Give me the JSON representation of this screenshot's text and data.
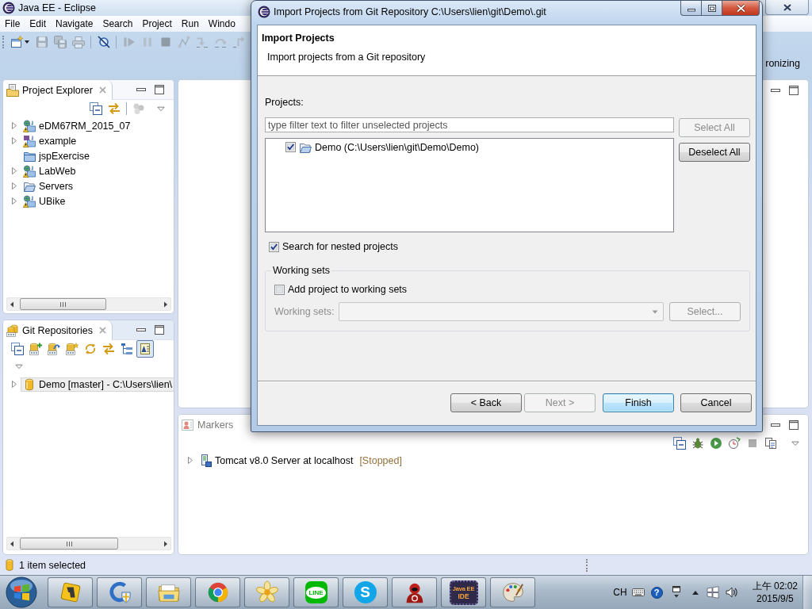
{
  "window": {
    "title": "Java EE - Eclipse"
  },
  "menu": [
    {
      "label": "File"
    },
    {
      "label": "Edit"
    },
    {
      "label": "Navigate"
    },
    {
      "label": "Search"
    },
    {
      "label": "Project"
    },
    {
      "label": "Run"
    },
    {
      "label": "Windo"
    }
  ],
  "toolbar": [
    {
      "kind": "new",
      "disabled": false
    },
    {
      "kind": "dropdown",
      "disabled": false
    },
    {
      "kind": "save",
      "disabled": true
    },
    {
      "kind": "save-all",
      "disabled": true
    },
    {
      "kind": "print",
      "disabled": true
    },
    {
      "kind": "separator"
    },
    {
      "kind": "skip-breakpoints",
      "disabled": false
    },
    {
      "kind": "separator"
    },
    {
      "kind": "resume",
      "disabled": true
    },
    {
      "kind": "suspend",
      "disabled": true
    },
    {
      "kind": "terminate",
      "disabled": true
    },
    {
      "kind": "disconnect",
      "disabled": true
    },
    {
      "kind": "step-into",
      "disabled": true
    },
    {
      "kind": "step-over",
      "disabled": true
    },
    {
      "kind": "step-return",
      "disabled": true
    },
    {
      "kind": "separator"
    }
  ],
  "perspective_bar": {
    "label": "ronizing"
  },
  "project_explorer": {
    "title": "Project Explorer",
    "toolbar": [
      {
        "kind": "collapse-all",
        "disabled": false
      },
      {
        "kind": "link",
        "disabled": false
      },
      {
        "kind": "separator"
      },
      {
        "kind": "filters",
        "disabled": true
      },
      {
        "kind": "view-menu",
        "disabled": false
      }
    ],
    "items": [
      {
        "label": "eDM67RM_2015_07",
        "kind": "web-project",
        "expandable": true,
        "expanded": false,
        "selected": false
      },
      {
        "label": "example",
        "kind": "maven-project",
        "expandable": true,
        "expanded": false,
        "selected": false
      },
      {
        "label": "jspExercise",
        "kind": "closed-project",
        "expandable": false,
        "selected": false
      },
      {
        "label": "LabWeb",
        "kind": "web-project",
        "expandable": true,
        "expanded": false,
        "selected": false
      },
      {
        "label": "Servers",
        "kind": "folder",
        "expandable": true,
        "expanded": false,
        "selected": false
      },
      {
        "label": "UBike",
        "kind": "web-project",
        "expandable": true,
        "expanded": false,
        "selected": false
      }
    ]
  },
  "git_repositories": {
    "title": "Git Repositories",
    "toolbar": [
      {
        "kind": "collapse-all",
        "pressed": false
      },
      {
        "kind": "add-repository",
        "pressed": false
      },
      {
        "kind": "clone-repository",
        "pressed": false
      },
      {
        "kind": "create-repository",
        "pressed": false
      },
      {
        "kind": "refresh",
        "pressed": false
      },
      {
        "kind": "link",
        "pressed": false
      },
      {
        "kind": "hierarchy",
        "pressed": false
      },
      {
        "kind": "show-details",
        "pressed": true
      }
    ],
    "items": [
      {
        "label": "Demo [master] - C:\\Users\\lien\\",
        "kind": "repository",
        "expandable": true,
        "expanded": false,
        "selected": true
      }
    ]
  },
  "servers_view": {
    "tabs": [
      {
        "label": "Markers",
        "selected": false
      }
    ],
    "toolbar": [
      {
        "kind": "collapse-all",
        "disabled": false
      },
      {
        "kind": "debug",
        "disabled": false
      },
      {
        "kind": "start",
        "disabled": false
      },
      {
        "kind": "profile",
        "disabled": false
      },
      {
        "kind": "stop",
        "disabled": true
      },
      {
        "kind": "publish",
        "disabled": false
      }
    ],
    "servers": [
      {
        "name": "Tomcat v8.0 Server at localhost",
        "status": "[Stopped]",
        "expandable": true,
        "expanded": false,
        "selected": false
      }
    ]
  },
  "status_bar": {
    "text": "1 item selected"
  },
  "dialog": {
    "title": "Import Projects from Git Repository C:\\Users\\lien\\git\\Demo\\.git",
    "heading": "Import Projects",
    "description": "Import projects from a Git repository",
    "projects_label": "Projects:",
    "filter": {
      "placeholder": "type filter text to filter unselected projects"
    },
    "side_buttons": [
      {
        "label": "Select All",
        "disabled": true
      },
      {
        "label": "Deselect All",
        "disabled": false
      }
    ],
    "projects": [
      {
        "label": "Demo (C:\\Users\\lien\\git\\Demo\\Demo)",
        "checked": true
      }
    ],
    "nested": {
      "label": "Search for nested projects",
      "checked": true
    },
    "working_sets": {
      "title": "Working sets",
      "add": {
        "label": "Add project to working sets",
        "checked": false
      },
      "field_label": "Working sets:",
      "disabled": true,
      "select_button": "Select..."
    },
    "buttons": [
      {
        "label": "< Back",
        "disabled": false,
        "default": false
      },
      {
        "label": "Next >",
        "disabled": true,
        "default": false
      },
      {
        "label": "Finish",
        "disabled": false,
        "default": true
      },
      {
        "label": "Cancel",
        "disabled": false,
        "default": false
      }
    ]
  },
  "taskbar": {
    "apps": [
      {
        "kind": "diamond-tile"
      },
      {
        "kind": "shield-c"
      },
      {
        "kind": "folder"
      },
      {
        "kind": "segmented-circle"
      },
      {
        "kind": "flower"
      },
      {
        "kind": "speech-bubble",
        "text": "LINE"
      },
      {
        "kind": "letter-circle",
        "text": "S"
      },
      {
        "kind": "hooded-figure"
      },
      {
        "kind": "gear-logo",
        "lines": [
          "Java EE",
          "IDE"
        ]
      },
      {
        "kind": "palette"
      }
    ],
    "tray": {
      "language": "CH",
      "help_glyph": "?",
      "time": "上午 02:02",
      "date": "2015/9/5"
    }
  }
}
